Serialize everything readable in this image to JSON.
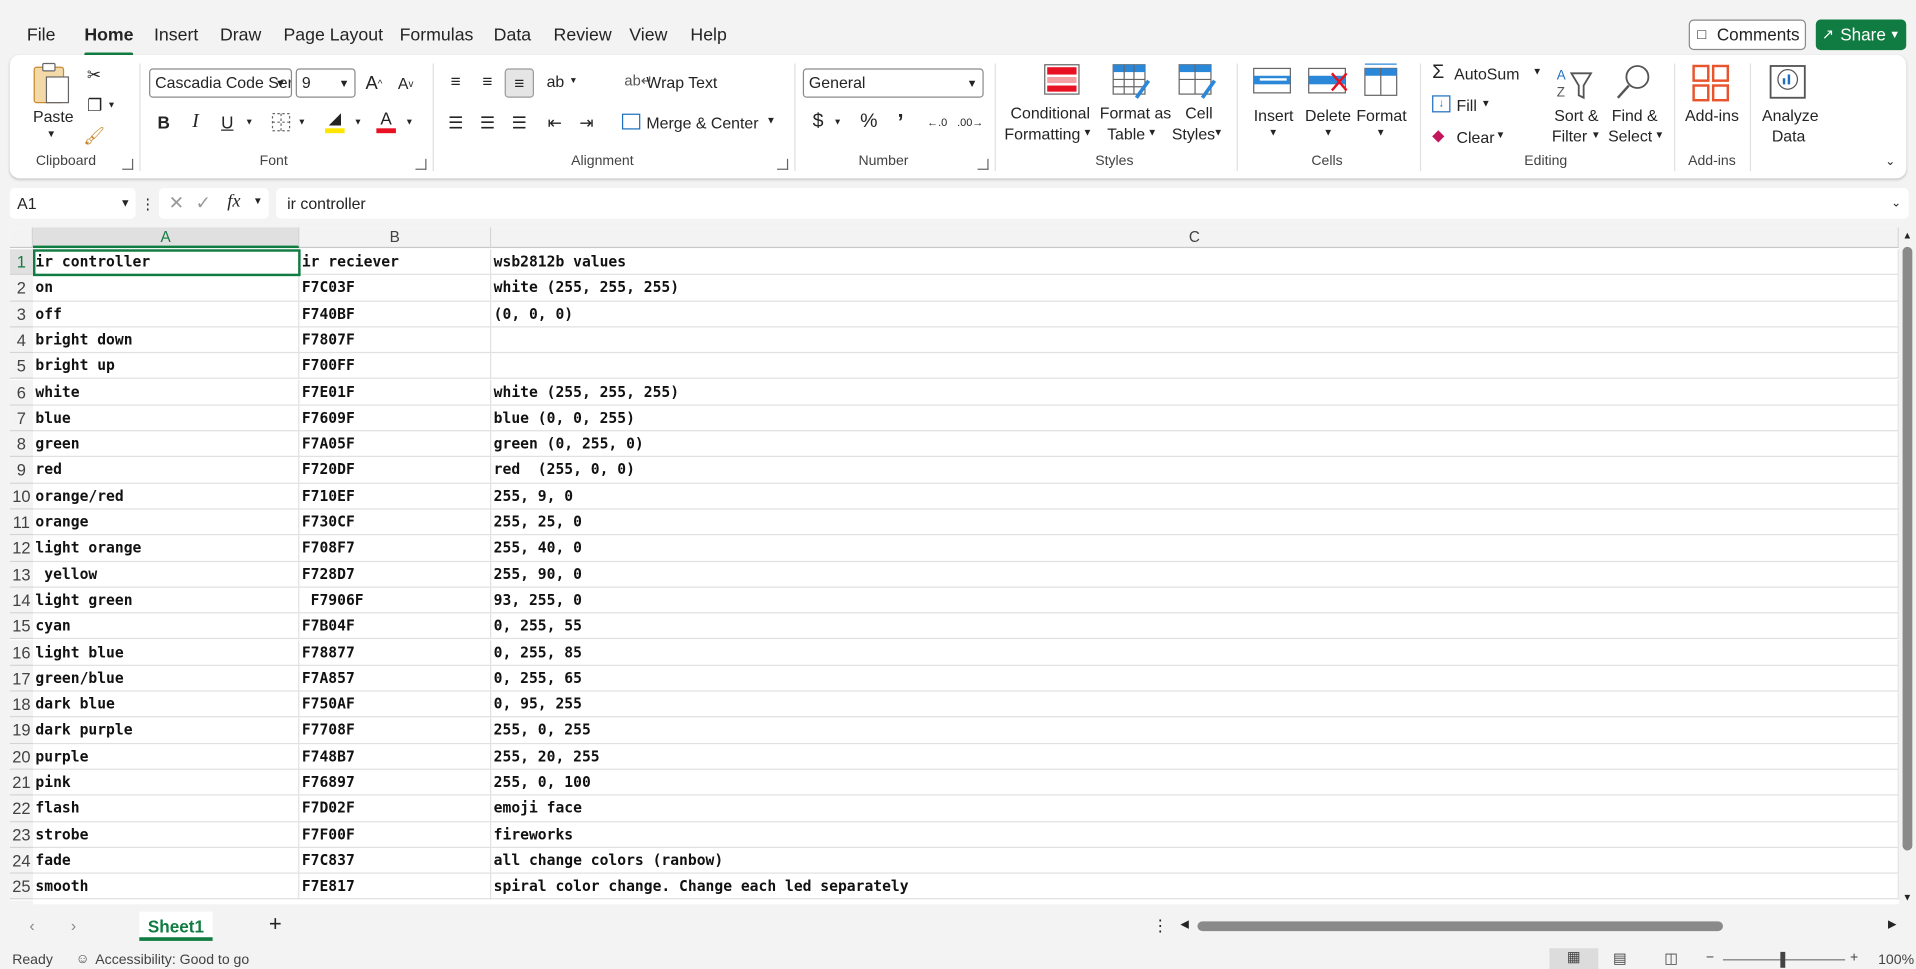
{
  "menu": {
    "file": "File",
    "home": "Home",
    "insert": "Insert",
    "draw": "Draw",
    "page_layout": "Page Layout",
    "formulas": "Formulas",
    "data": "Data",
    "review": "Review",
    "view": "View",
    "help": "Help"
  },
  "topbar": {
    "comments": "Comments",
    "share": "Share"
  },
  "ribbon": {
    "clipboard": {
      "paste": "Paste",
      "label": "Clipboard"
    },
    "font": {
      "name": "Cascadia Code Ser",
      "size": "9",
      "label": "Font"
    },
    "alignment": {
      "wrap_text": "Wrap Text",
      "merge_center": "Merge & Center",
      "label": "Alignment"
    },
    "number": {
      "format": "General",
      "label": "Number"
    },
    "styles": {
      "conditional_1": "Conditional",
      "conditional_2": "Formatting",
      "format_table_1": "Format as",
      "format_table_2": "Table",
      "cell_styles_1": "Cell",
      "cell_styles_2": "Styles",
      "label": "Styles"
    },
    "cells": {
      "insert": "Insert",
      "delete": "Delete",
      "format": "Format",
      "label": "Cells"
    },
    "editing": {
      "autosum": "AutoSum",
      "fill": "Fill",
      "clear": "Clear",
      "sort_1": "Sort &",
      "sort_2": "Filter",
      "find_1": "Find &",
      "find_2": "Select",
      "label": "Editing"
    },
    "addins": {
      "addins": "Add-ins",
      "label": "Add-ins"
    },
    "analyze": {
      "line1": "Analyze",
      "line2": "Data"
    }
  },
  "formula_bar": {
    "name_box": "A1",
    "fx": "fx",
    "value": "ir controller"
  },
  "columns": [
    "A",
    "B",
    "C"
  ],
  "rows": [
    {
      "n": "1",
      "a": "ir controller",
      "b": "ir reciever",
      "c": "wsb2812b values"
    },
    {
      "n": "2",
      "a": "on",
      "b": "F7C03F",
      "c": "white (255, 255, 255)"
    },
    {
      "n": "3",
      "a": "off",
      "b": "F740BF",
      "c": "(0, 0, 0)"
    },
    {
      "n": "4",
      "a": "bright down",
      "b": "F7807F",
      "c": ""
    },
    {
      "n": "5",
      "a": "bright up",
      "b": "F700FF",
      "c": ""
    },
    {
      "n": "6",
      "a": "white",
      "b": "F7E01F",
      "c": "white (255, 255, 255)"
    },
    {
      "n": "7",
      "a": "blue",
      "b": "F7609F",
      "c": "blue (0, 0, 255)"
    },
    {
      "n": "8",
      "a": "green",
      "b": "F7A05F",
      "c": "green (0, 255, 0)"
    },
    {
      "n": "9",
      "a": "red",
      "b": "F720DF",
      "c": "red  (255, 0, 0)"
    },
    {
      "n": "10",
      "a": "orange/red",
      "b": "F710EF",
      "c": "255, 9, 0"
    },
    {
      "n": "11",
      "a": "orange",
      "b": "F730CF",
      "c": "255, 25, 0"
    },
    {
      "n": "12",
      "a": "light orange",
      "b": "F708F7",
      "c": "255, 40, 0"
    },
    {
      "n": "13",
      "a": " yellow",
      "b": "F728D7",
      "c": "255, 90, 0"
    },
    {
      "n": "14",
      "a": "light green",
      "b": " F7906F",
      "c": "93, 255, 0"
    },
    {
      "n": "15",
      "a": "cyan",
      "b": "F7B04F",
      "c": "0, 255, 55"
    },
    {
      "n": "16",
      "a": "light blue",
      "b": "F78877",
      "c": "0, 255, 85"
    },
    {
      "n": "17",
      "a": "green/blue",
      "b": "F7A857",
      "c": "0, 255, 65"
    },
    {
      "n": "18",
      "a": "dark blue",
      "b": "F750AF",
      "c": "0, 95, 255"
    },
    {
      "n": "19",
      "a": "dark purple",
      "b": "F7708F",
      "c": "255, 0, 255"
    },
    {
      "n": "20",
      "a": "purple",
      "b": "F748B7",
      "c": "255, 20, 255"
    },
    {
      "n": "21",
      "a": "pink",
      "b": "F76897",
      "c": "255, 0, 100"
    },
    {
      "n": "22",
      "a": "flash",
      "b": "F7D02F",
      "c": "emoji face"
    },
    {
      "n": "23",
      "a": "strobe",
      "b": "F7F00F",
      "c": "fireworks"
    },
    {
      "n": "24",
      "a": "fade",
      "b": "F7C837",
      "c": "all change colors (ranbow)"
    },
    {
      "n": "25",
      "a": "smooth",
      "b": "F7E817",
      "c": "spiral color change. Change each led separately"
    }
  ],
  "sheets": {
    "tab": "Sheet1",
    "add": "+"
  },
  "status": {
    "ready": "Ready",
    "accessibility": "Accessibility: Good to go",
    "zoom": "100%"
  },
  "colors": {
    "accent": "#107c41",
    "selection": "#107c41",
    "font_red": "#e81123",
    "highlight_yellow": "#ffe600"
  }
}
